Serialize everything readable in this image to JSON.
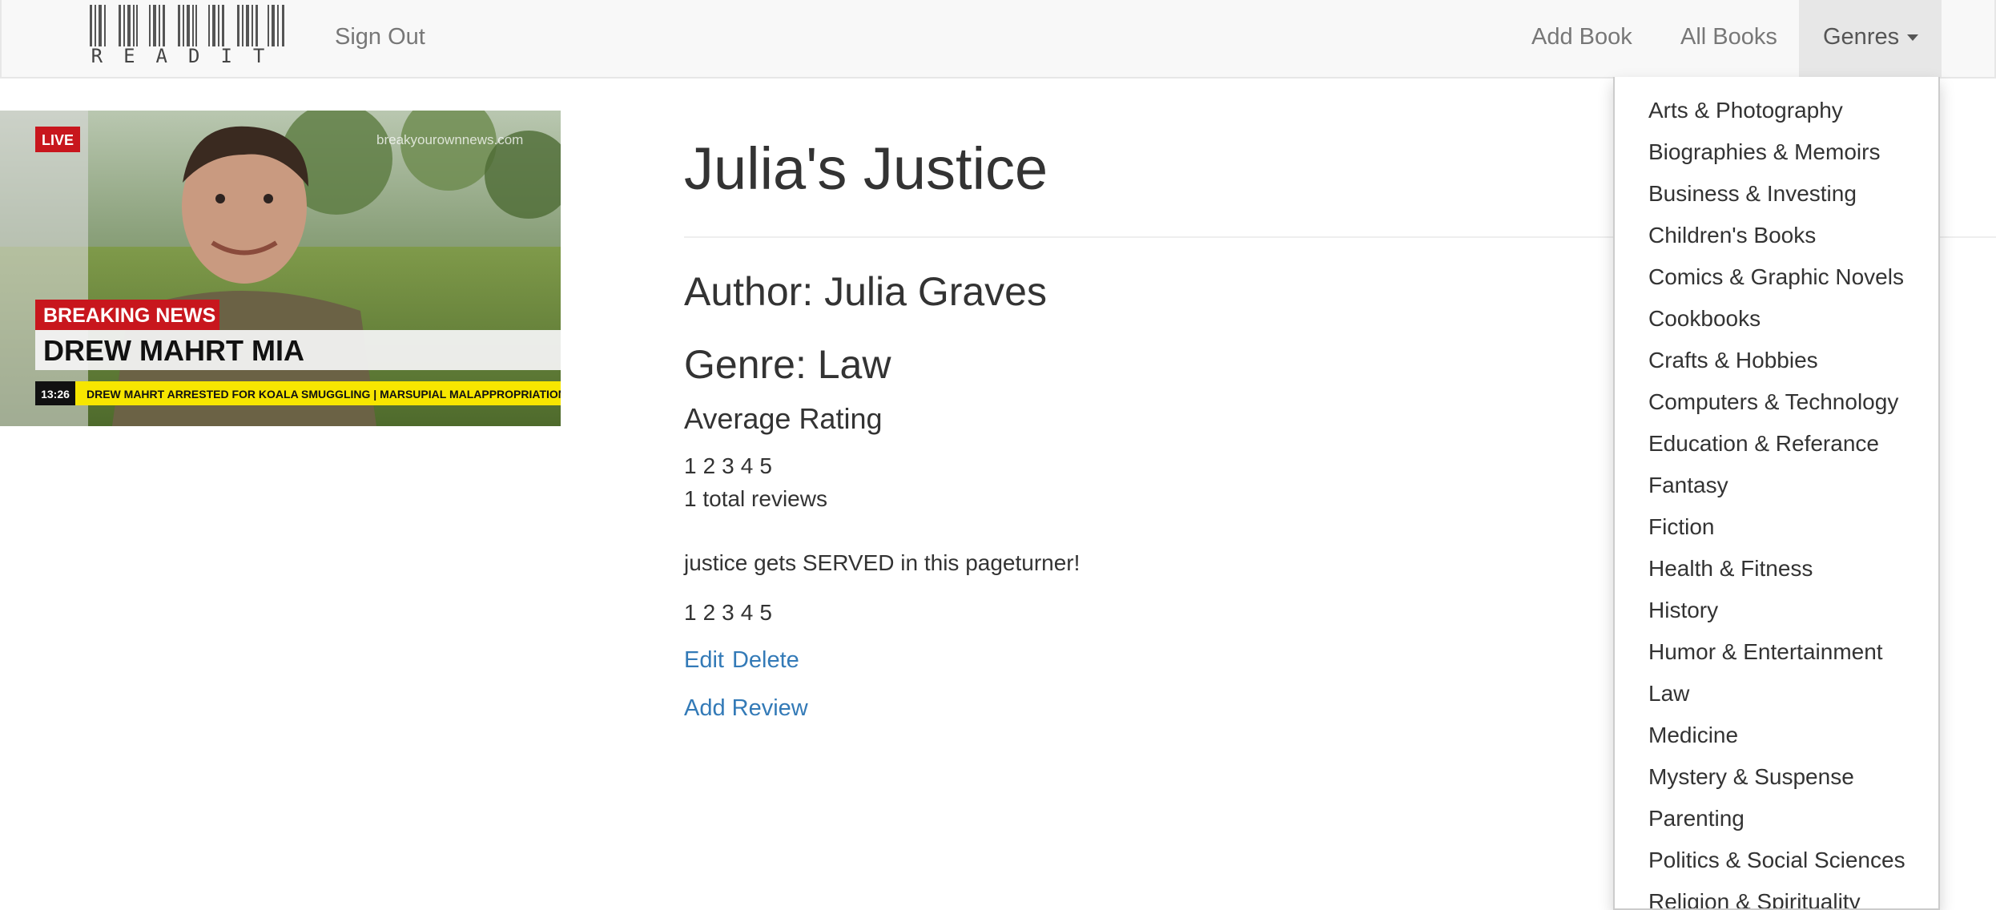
{
  "navbar": {
    "brand": "READIT",
    "sign_out": "Sign Out",
    "add_book": "Add Book",
    "all_books": "All Books",
    "genres": "Genres"
  },
  "cover": {
    "live_badge": "LIVE",
    "source_watermark": "breakyourownnews.com",
    "breaking_label": "BREAKING NEWS",
    "headline": "DREW MAHRT MIA",
    "time": "13:26",
    "ticker": "DREW MAHRT ARRESTED FOR KOALA SMUGGLING | MARSUPIAL MALAPPROPRIATION I"
  },
  "book": {
    "title": "Julia's Justice",
    "author_line": "Author: Julia Graves",
    "genre_line": "Genre: Law",
    "average_rating_heading": "Average Rating",
    "avg_stars": [
      "1",
      "2",
      "3",
      "4",
      "5"
    ],
    "total_reviews": "1 total reviews"
  },
  "review": {
    "text": "justice gets SERVED in this pageturner!",
    "stars": [
      "1",
      "2",
      "3",
      "4",
      "5"
    ],
    "edit": "Edit",
    "delete": "Delete"
  },
  "add_review": "Add Review",
  "genres_menu": [
    "Arts & Photography",
    "Biographies & Memoirs",
    "Business & Investing",
    "Children's Books",
    "Comics & Graphic Novels",
    "Cookbooks",
    "Crafts & Hobbies",
    "Computers & Technology",
    "Education & Referance",
    "Fantasy",
    "Fiction",
    "Health & Fitness",
    "History",
    "Humor & Entertainment",
    "Law",
    "Medicine",
    "Mystery & Suspense",
    "Parenting",
    "Politics & Social Sciences",
    "Religion & Spirituality"
  ],
  "colors": {
    "link": "#337ab7",
    "navbar_bg": "#f8f8f8",
    "nav_text": "#777777",
    "breaking_red": "#c8161d",
    "ticker_yellow": "#f7e600"
  }
}
